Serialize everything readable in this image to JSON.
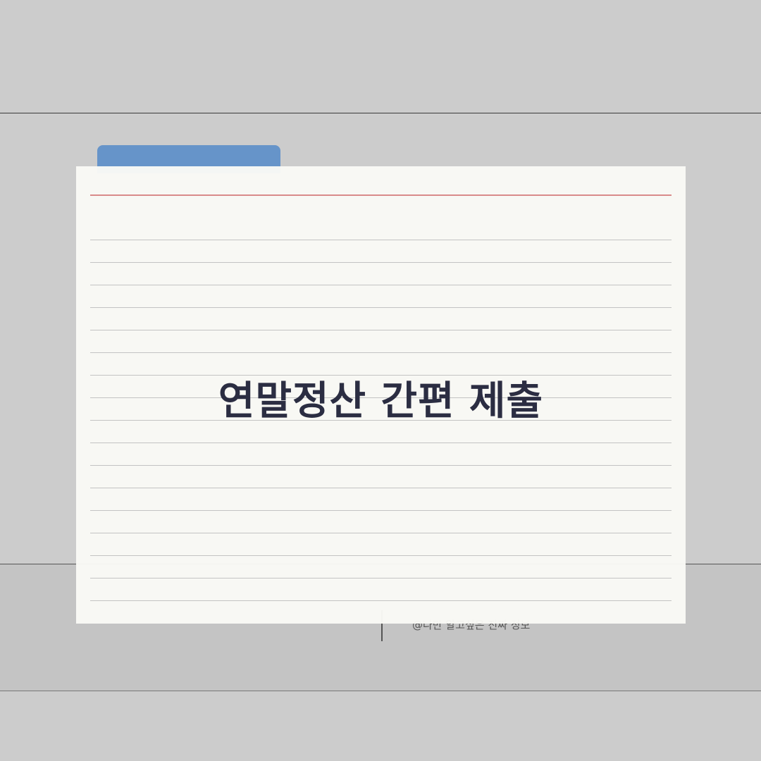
{
  "card": {
    "title": "연말정산 간편 제출"
  },
  "footer": {
    "credit": "@나만 알고싶은 진짜 정보"
  },
  "colors": {
    "background": "#cccccc",
    "tab": "#6694c9",
    "card": "#fafaf6",
    "margin_line": "#d98a8a",
    "title_text": "#2b2d42"
  }
}
